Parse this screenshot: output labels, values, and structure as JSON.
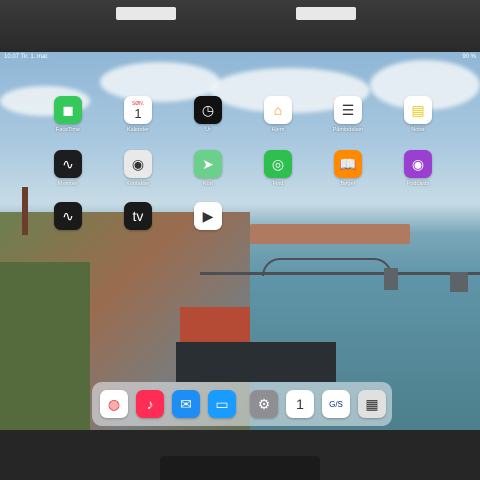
{
  "status_bar": {
    "time": "10.07",
    "date": "Tir. 1. mar.",
    "battery": "90 %"
  },
  "apps": [
    {
      "label": "FaceTime",
      "icon": "facetime-icon",
      "color": "#36c85a",
      "glyph": "◼"
    },
    {
      "label": "Kalender",
      "icon": "calendar-icon",
      "color": "#ffffff",
      "glyph": "1",
      "day": "SØN."
    },
    {
      "label": "Ur",
      "icon": "clock-icon",
      "color": "#111111",
      "glyph": "◷"
    },
    {
      "label": "Hjem",
      "icon": "home-icon",
      "color": "#ffffff",
      "glyph": "⌂"
    },
    {
      "label": "Påmindelser",
      "icon": "reminders-icon",
      "color": "#ffffff",
      "glyph": "☰"
    },
    {
      "label": "Noter",
      "icon": "notes-icon",
      "color": "#ffffff",
      "glyph": "▤"
    },
    {
      "label": "Memoer",
      "icon": "voice-memos-icon",
      "color": "#1d1d1f",
      "glyph": "∿"
    },
    {
      "label": "Kontakter",
      "icon": "contacts-icon",
      "color": "#e9e9e9",
      "glyph": "◉"
    },
    {
      "label": "Kort",
      "icon": "maps-icon",
      "color": "#6ad08b",
      "glyph": "➤"
    },
    {
      "label": "Find",
      "icon": "find-my-icon",
      "color": "#2fbf4f",
      "glyph": "◎"
    },
    {
      "label": "Bøger",
      "icon": "books-icon",
      "color": "#ff8a00",
      "glyph": "📖"
    },
    {
      "label": "Podcasts",
      "icon": "podcasts-icon",
      "color": "#9b3fd1",
      "glyph": "◉"
    },
    {
      "label": "",
      "icon": "stocks-icon",
      "color": "#1a1a1a",
      "glyph": "∿"
    },
    {
      "label": "",
      "icon": "appletv-icon",
      "color": "#1a1a1a",
      "glyph": "tv"
    },
    {
      "label": "",
      "icon": "zoom-icon",
      "color": "#ffffff",
      "glyph": "▶"
    }
  ],
  "dock": [
    {
      "icon": "chrome-icon",
      "color": "#ffffff",
      "glyph": "◍"
    },
    {
      "icon": "music-icon",
      "color": "#ff2d55",
      "glyph": "♪"
    },
    {
      "icon": "mail-icon",
      "color": "#1e8ef5",
      "glyph": "✉"
    },
    {
      "icon": "files-icon",
      "color": "#1a9bff",
      "glyph": "▭"
    },
    {
      "icon": "settings-icon",
      "color": "#8e8e93",
      "glyph": "⚙"
    },
    {
      "icon": "calendar-icon",
      "color": "#ffffff",
      "glyph": "1"
    },
    {
      "icon": "gls-icon",
      "color": "#ffffff",
      "glyph": "G/S"
    },
    {
      "icon": "app-library-icon",
      "color": "#e0e0e0",
      "glyph": "▦"
    }
  ]
}
